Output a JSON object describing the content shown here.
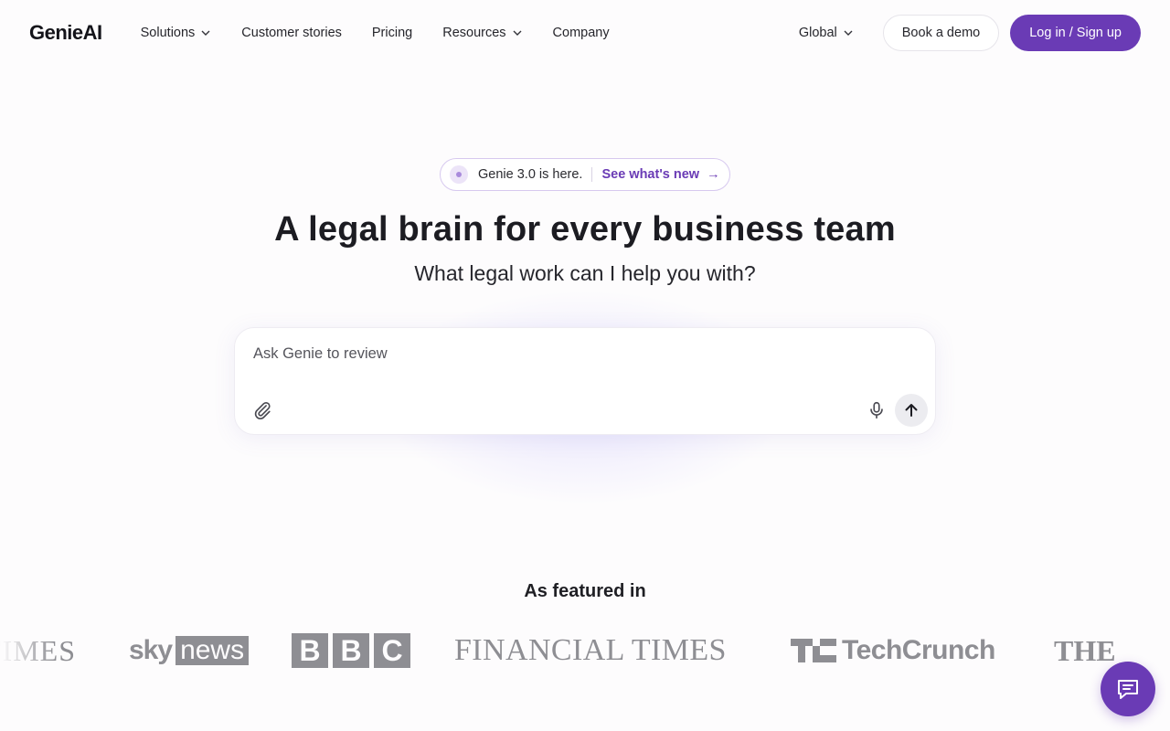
{
  "nav": {
    "logo": "GenieAI",
    "links": [
      {
        "label": "Solutions",
        "has_dropdown": true
      },
      {
        "label": "Customer stories",
        "has_dropdown": false
      },
      {
        "label": "Pricing",
        "has_dropdown": false
      },
      {
        "label": "Resources",
        "has_dropdown": true
      },
      {
        "label": "Company",
        "has_dropdown": false
      }
    ],
    "region": "Global",
    "demo_label": "Book a demo",
    "login_label": "Log in / Sign up"
  },
  "badge": {
    "text": "Genie 3.0 is here.",
    "link": "See what's new",
    "arrow": "→"
  },
  "hero": {
    "title": "A legal brain for every business team",
    "subtitle": "What legal work can I help you with?"
  },
  "prompt": {
    "placeholder": "Ask Genie to review",
    "attach_icon": "paperclip-icon",
    "mic_icon": "microphone-icon",
    "send_icon": "arrow-up-icon"
  },
  "featured": {
    "heading": "As featured in",
    "logos": [
      {
        "name": "times",
        "text": "TIMES"
      },
      {
        "name": "sky-news",
        "sky": "sky",
        "news": "news"
      },
      {
        "name": "bbc",
        "letters": [
          "B",
          "B",
          "C"
        ]
      },
      {
        "name": "financial-times",
        "text": "FINANCIAL TIMES"
      },
      {
        "name": "techcrunch",
        "text": "TechCrunch"
      },
      {
        "name": "the",
        "text": "THE"
      }
    ]
  },
  "colors": {
    "accent": "#6a3bb5",
    "logo_gray": "#8e8e93",
    "background": "#fdfcfd"
  },
  "chat": {
    "icon": "chat-bubble-icon"
  }
}
